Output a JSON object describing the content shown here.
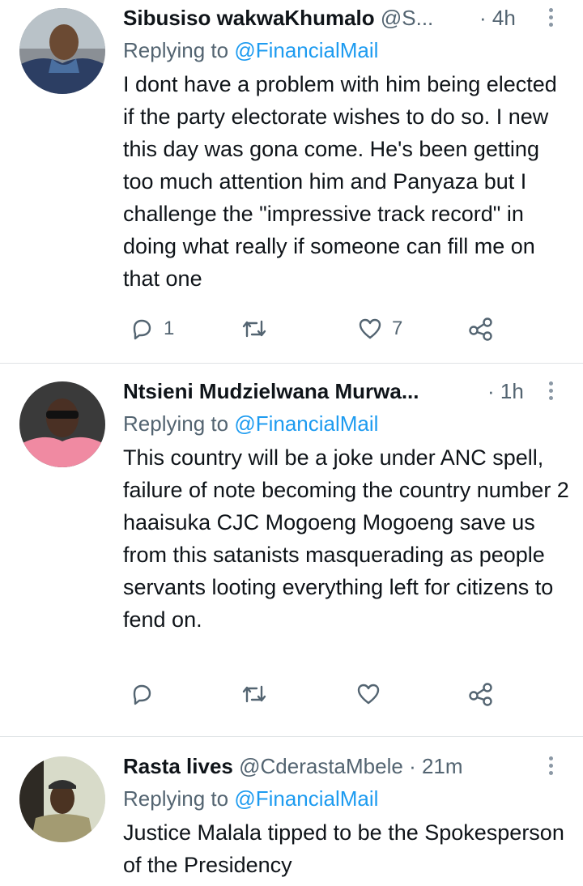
{
  "tweets": [
    {
      "name": "Sibusiso wakwaKhumalo",
      "handle": "@S...",
      "time": "· 4h",
      "replying_label": "Replying to ",
      "replying_to": "@FinancialMail",
      "text": "I dont have a problem with him being elected if the party electorate wishes to do so. I new this day was gona come. He's been getting too much attention him and Panyaza but I challenge the \"impressive track record\" in doing what really if someone can fill me on that one",
      "replies": "1",
      "retweets": "",
      "likes": "7"
    },
    {
      "name": "Ntsieni Mudzielwana Murwa...",
      "handle": "",
      "time": "· 1h",
      "replying_label": "Replying to ",
      "replying_to": "@FinancialMail",
      "text": "This country will be a joke under ANC spell, failure of note becoming the country number 2 haaisuka CJC Mogoeng Mogoeng save us from this satanists masquerading as people servants looting everything left for citizens to fend on.",
      "replies": "",
      "retweets": "",
      "likes": ""
    },
    {
      "name": "Rasta lives",
      "handle": "@CderastaMbele",
      "time": "· 21m",
      "replying_label": "Replying to ",
      "replying_to": "@FinancialMail",
      "text": "Justice Malala tipped to be the Spokesperson of the Presidency"
    }
  ],
  "colors": {
    "accent": "#1d9bf0",
    "secondary_text": "#536471",
    "divider": "#dfe3e6"
  },
  "icons": [
    "reply-icon",
    "retweet-icon",
    "like-icon",
    "share-icon",
    "more-options-icon"
  ]
}
